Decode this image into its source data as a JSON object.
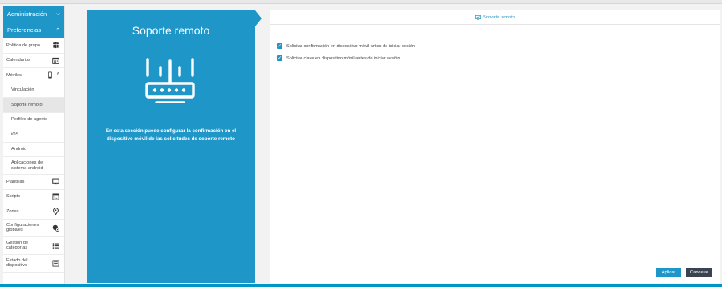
{
  "sidebar": {
    "sections": [
      {
        "label": "Administración"
      },
      {
        "label": "Preferencias"
      }
    ],
    "items": [
      {
        "label": "Política de grupo",
        "icon": "users-icon"
      },
      {
        "label": "Calendarios",
        "icon": "calendar-icon"
      },
      {
        "label": "Móviles",
        "icon": "mobile-icon"
      },
      {
        "label": "Vinculación"
      },
      {
        "label": "Soporte remoto"
      },
      {
        "label": "Perfiles de agente"
      },
      {
        "label": "iOS"
      },
      {
        "label": "Android"
      },
      {
        "label": "Aplicaciones del sistema android"
      },
      {
        "label": "Plantillas",
        "icon": "monitor-icon"
      },
      {
        "label": "Scripts",
        "icon": "script-icon"
      },
      {
        "label": "Zonas",
        "icon": "location-pin-icon"
      },
      {
        "label": "Configuraciones globales",
        "icon": "globe-gear-icon"
      },
      {
        "label": "Gestión de categorías",
        "icon": "list-icon"
      },
      {
        "label": "Estado del dispositivo",
        "icon": "device-status-icon"
      }
    ]
  },
  "info": {
    "title": "Soporte remoto",
    "description": "En esta sección puede configurar la confirmación en el dispositivo móvil de las solicitudes de soporte remoto"
  },
  "main": {
    "header": "Soporte remoto",
    "options": [
      {
        "label": "Solicitar confirmación en dispositivo móvil antes de iniciar sesión",
        "checked": true
      },
      {
        "label": "Solicitar clave en dispositivo móvil antes de iniciar sesión",
        "checked": true
      }
    ],
    "apply_label": "Aplicar",
    "cancel_label": "Cancelar"
  },
  "colors": {
    "accent": "#1e96c8",
    "dark_button": "#3a4450"
  }
}
